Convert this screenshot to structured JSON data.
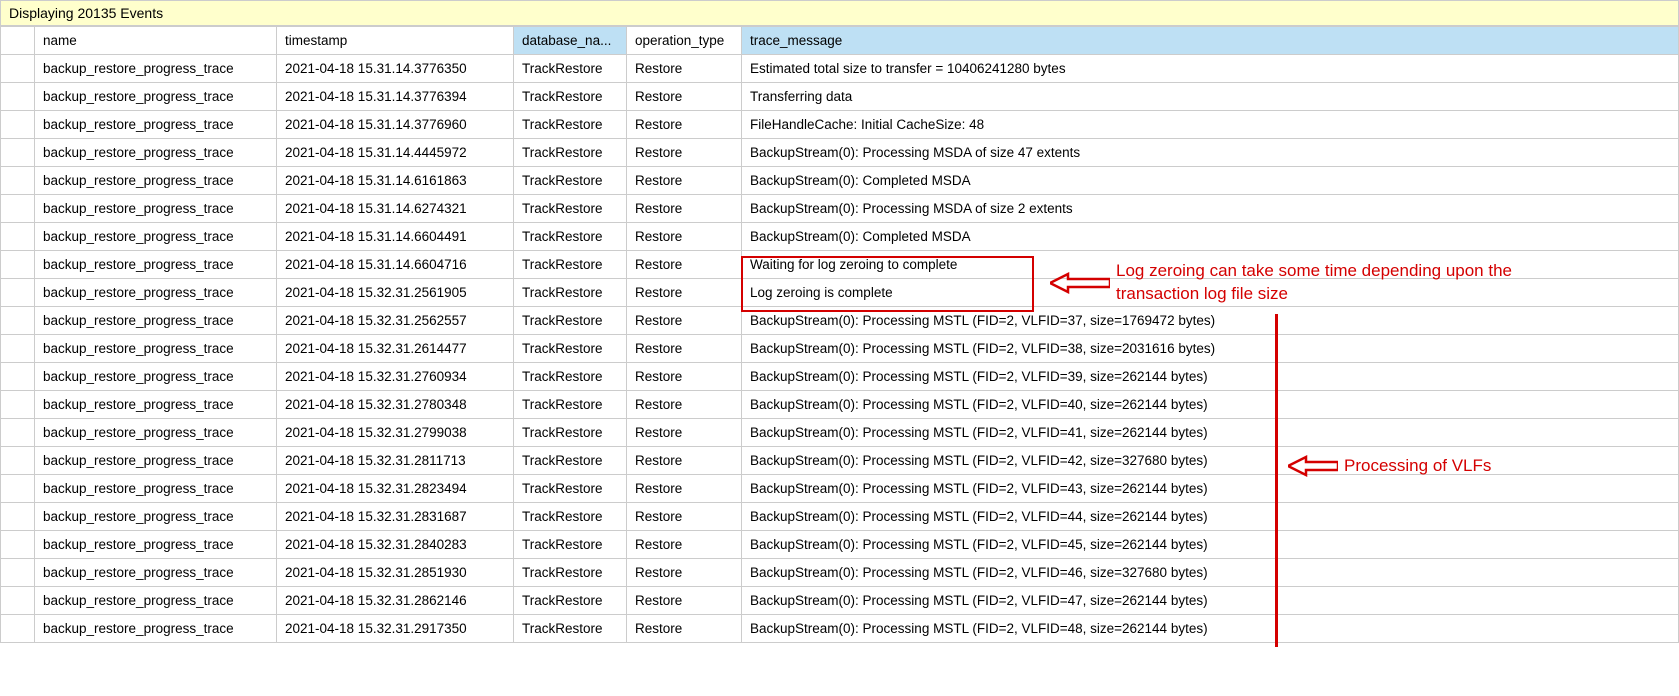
{
  "status_bar": "Displaying 20135 Events",
  "columns": {
    "name": "name",
    "timestamp": "timestamp",
    "database_name": "database_na...",
    "operation_type": "operation_type",
    "trace_message": "trace_message"
  },
  "rows": [
    {
      "name": "backup_restore_progress_trace",
      "timestamp": "2021-04-18 15.31.14.3776350",
      "database_name": "TrackRestore",
      "operation_type": "Restore",
      "trace_message": "Estimated total size to transfer = 10406241280 bytes"
    },
    {
      "name": "backup_restore_progress_trace",
      "timestamp": "2021-04-18 15.31.14.3776394",
      "database_name": "TrackRestore",
      "operation_type": "Restore",
      "trace_message": "Transferring data"
    },
    {
      "name": "backup_restore_progress_trace",
      "timestamp": "2021-04-18 15.31.14.3776960",
      "database_name": "TrackRestore",
      "operation_type": "Restore",
      "trace_message": "FileHandleCache: Initial CacheSize: 48"
    },
    {
      "name": "backup_restore_progress_trace",
      "timestamp": "2021-04-18 15.31.14.4445972",
      "database_name": "TrackRestore",
      "operation_type": "Restore",
      "trace_message": "BackupStream(0): Processing MSDA of size 47 extents"
    },
    {
      "name": "backup_restore_progress_trace",
      "timestamp": "2021-04-18 15.31.14.6161863",
      "database_name": "TrackRestore",
      "operation_type": "Restore",
      "trace_message": "BackupStream(0): Completed MSDA"
    },
    {
      "name": "backup_restore_progress_trace",
      "timestamp": "2021-04-18 15.31.14.6274321",
      "database_name": "TrackRestore",
      "operation_type": "Restore",
      "trace_message": "BackupStream(0): Processing MSDA of size 2 extents"
    },
    {
      "name": "backup_restore_progress_trace",
      "timestamp": "2021-04-18 15.31.14.6604491",
      "database_name": "TrackRestore",
      "operation_type": "Restore",
      "trace_message": "BackupStream(0): Completed MSDA"
    },
    {
      "name": "backup_restore_progress_trace",
      "timestamp": "2021-04-18 15.31.14.6604716",
      "database_name": "TrackRestore",
      "operation_type": "Restore",
      "trace_message": "Waiting for log zeroing to complete"
    },
    {
      "name": "backup_restore_progress_trace",
      "timestamp": "2021-04-18 15.32.31.2561905",
      "database_name": "TrackRestore",
      "operation_type": "Restore",
      "trace_message": "Log zeroing is complete"
    },
    {
      "name": "backup_restore_progress_trace",
      "timestamp": "2021-04-18 15.32.31.2562557",
      "database_name": "TrackRestore",
      "operation_type": "Restore",
      "trace_message": "BackupStream(0): Processing MSTL (FID=2, VLFID=37, size=1769472 bytes)"
    },
    {
      "name": "backup_restore_progress_trace",
      "timestamp": "2021-04-18 15.32.31.2614477",
      "database_name": "TrackRestore",
      "operation_type": "Restore",
      "trace_message": "BackupStream(0): Processing MSTL (FID=2, VLFID=38, size=2031616 bytes)"
    },
    {
      "name": "backup_restore_progress_trace",
      "timestamp": "2021-04-18 15.32.31.2760934",
      "database_name": "TrackRestore",
      "operation_type": "Restore",
      "trace_message": "BackupStream(0): Processing MSTL (FID=2, VLFID=39, size=262144 bytes)"
    },
    {
      "name": "backup_restore_progress_trace",
      "timestamp": "2021-04-18 15.32.31.2780348",
      "database_name": "TrackRestore",
      "operation_type": "Restore",
      "trace_message": "BackupStream(0): Processing MSTL (FID=2, VLFID=40, size=262144 bytes)"
    },
    {
      "name": "backup_restore_progress_trace",
      "timestamp": "2021-04-18 15.32.31.2799038",
      "database_name": "TrackRestore",
      "operation_type": "Restore",
      "trace_message": "BackupStream(0): Processing MSTL (FID=2, VLFID=41, size=262144 bytes)"
    },
    {
      "name": "backup_restore_progress_trace",
      "timestamp": "2021-04-18 15.32.31.2811713",
      "database_name": "TrackRestore",
      "operation_type": "Restore",
      "trace_message": "BackupStream(0): Processing MSTL (FID=2, VLFID=42, size=327680 bytes)"
    },
    {
      "name": "backup_restore_progress_trace",
      "timestamp": "2021-04-18 15.32.31.2823494",
      "database_name": "TrackRestore",
      "operation_type": "Restore",
      "trace_message": "BackupStream(0): Processing MSTL (FID=2, VLFID=43, size=262144 bytes)"
    },
    {
      "name": "backup_restore_progress_trace",
      "timestamp": "2021-04-18 15.32.31.2831687",
      "database_name": "TrackRestore",
      "operation_type": "Restore",
      "trace_message": "BackupStream(0): Processing MSTL (FID=2, VLFID=44, size=262144 bytes)"
    },
    {
      "name": "backup_restore_progress_trace",
      "timestamp": "2021-04-18 15.32.31.2840283",
      "database_name": "TrackRestore",
      "operation_type": "Restore",
      "trace_message": "BackupStream(0): Processing MSTL (FID=2, VLFID=45, size=262144 bytes)"
    },
    {
      "name": "backup_restore_progress_trace",
      "timestamp": "2021-04-18 15.32.31.2851930",
      "database_name": "TrackRestore",
      "operation_type": "Restore",
      "trace_message": "BackupStream(0): Processing MSTL (FID=2, VLFID=46, size=327680 bytes)"
    },
    {
      "name": "backup_restore_progress_trace",
      "timestamp": "2021-04-18 15.32.31.2862146",
      "database_name": "TrackRestore",
      "operation_type": "Restore",
      "trace_message": "BackupStream(0): Processing MSTL (FID=2, VLFID=47, size=262144 bytes)"
    },
    {
      "name": "backup_restore_progress_trace",
      "timestamp": "2021-04-18 15.32.31.2917350",
      "database_name": "TrackRestore",
      "operation_type": "Restore",
      "trace_message": "BackupStream(0): Processing MSTL (FID=2, VLFID=48, size=262144 bytes)"
    }
  ],
  "annotations": {
    "log_zeroing": "Log zeroing can take some time depending upon the transaction log file size",
    "vlf": "Processing of VLFs"
  }
}
